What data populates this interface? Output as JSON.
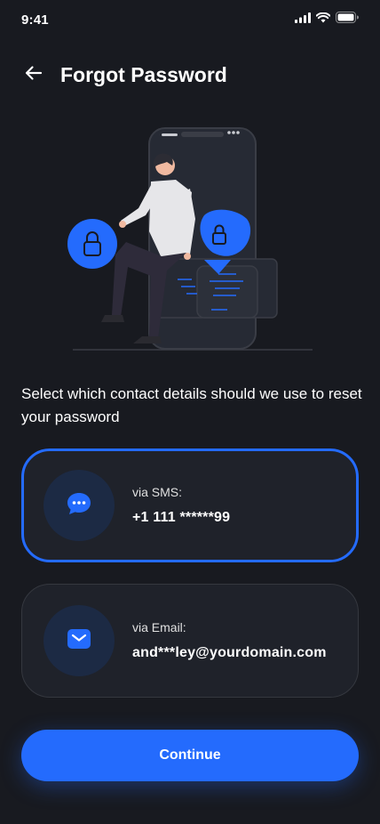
{
  "status_bar": {
    "time": "9:41",
    "icons": [
      "signal-icon",
      "wifi-icon",
      "battery-icon"
    ]
  },
  "header": {
    "back_icon": "arrow-left-icon",
    "title": "Forgot Password"
  },
  "description": "Select which contact details should we use to reset your password",
  "options": [
    {
      "icon": "chat-bubble-icon",
      "label": "via SMS:",
      "value": "+1 111 ******99",
      "selected": true
    },
    {
      "icon": "mail-icon",
      "label": "via Email:",
      "value": "and***ley@yourdomain.com",
      "selected": false
    }
  ],
  "continue_label": "Continue",
  "colors": {
    "background": "#181A20",
    "card": "#1F222A",
    "accent": "#246BFD",
    "border": "#35383F"
  }
}
